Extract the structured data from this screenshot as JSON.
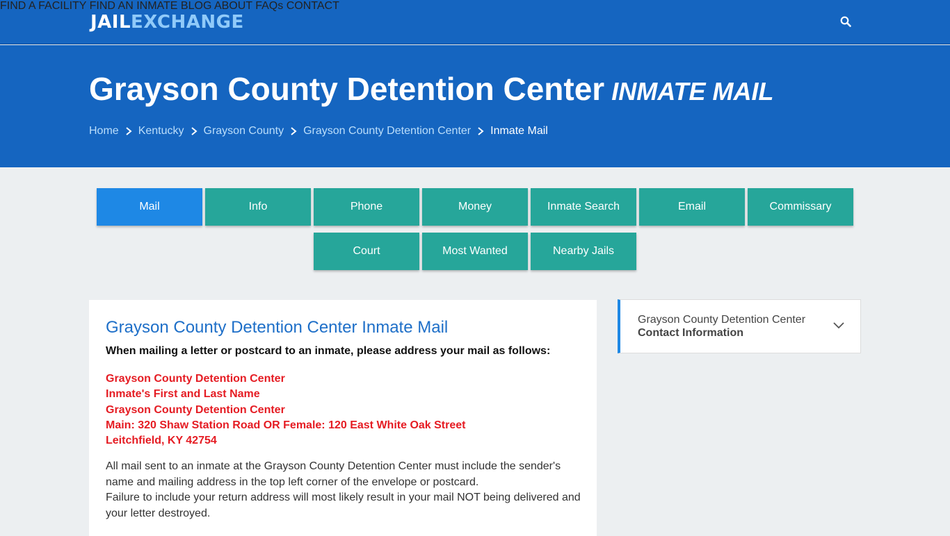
{
  "brand": {
    "part1": "JAIL",
    "part2": "EXCHANGE"
  },
  "nav": {
    "items": [
      "FIND A FACILITY",
      "FIND AN INMATE",
      "BLOG",
      "ABOUT",
      "FAQs",
      "CONTACT"
    ],
    "search_icon": "search-icon"
  },
  "hero": {
    "title": "Grayson County Detention Center",
    "subtitle": "INMATE MAIL",
    "breadcrumbs": [
      "Home",
      "Kentucky",
      "Grayson County",
      "Grayson County Detention Center",
      "Inmate Mail"
    ]
  },
  "tabs": {
    "row1": [
      "Mail",
      "Info",
      "Phone",
      "Money",
      "Inmate Search",
      "Email",
      "Commissary"
    ],
    "row2": [
      "Court",
      "Most Wanted",
      "Nearby Jails"
    ],
    "active": "Mail"
  },
  "main": {
    "heading": "Grayson County Detention Center Inmate Mail",
    "lead": "When mailing a letter or postcard to an inmate, please address your mail as follows:",
    "address": [
      "Grayson County Detention Center",
      "Inmate's First and Last Name",
      "Grayson County Detention Center",
      "Main: 320 Shaw Station Road OR Female: 120 East White Oak Street",
      "Leitchfield, KY 42754"
    ],
    "para1": "All mail sent to an inmate at the Grayson County Detention Center must include the sender's name and mailing address in the top left corner of the envelope or postcard.",
    "para2": "Failure to include your return address will most likely result in your mail NOT being delivered and your letter destroyed."
  },
  "sidebar": {
    "line1": "Grayson County Detention Center",
    "line2": "Contact Information",
    "icon": "chevron-down-icon"
  },
  "colors": {
    "header_blue": "#1565c0",
    "tab_teal": "#26a69a",
    "tab_active": "#1e88e5",
    "address_red": "#e51c23",
    "heading_blue": "#1e6fc8"
  }
}
